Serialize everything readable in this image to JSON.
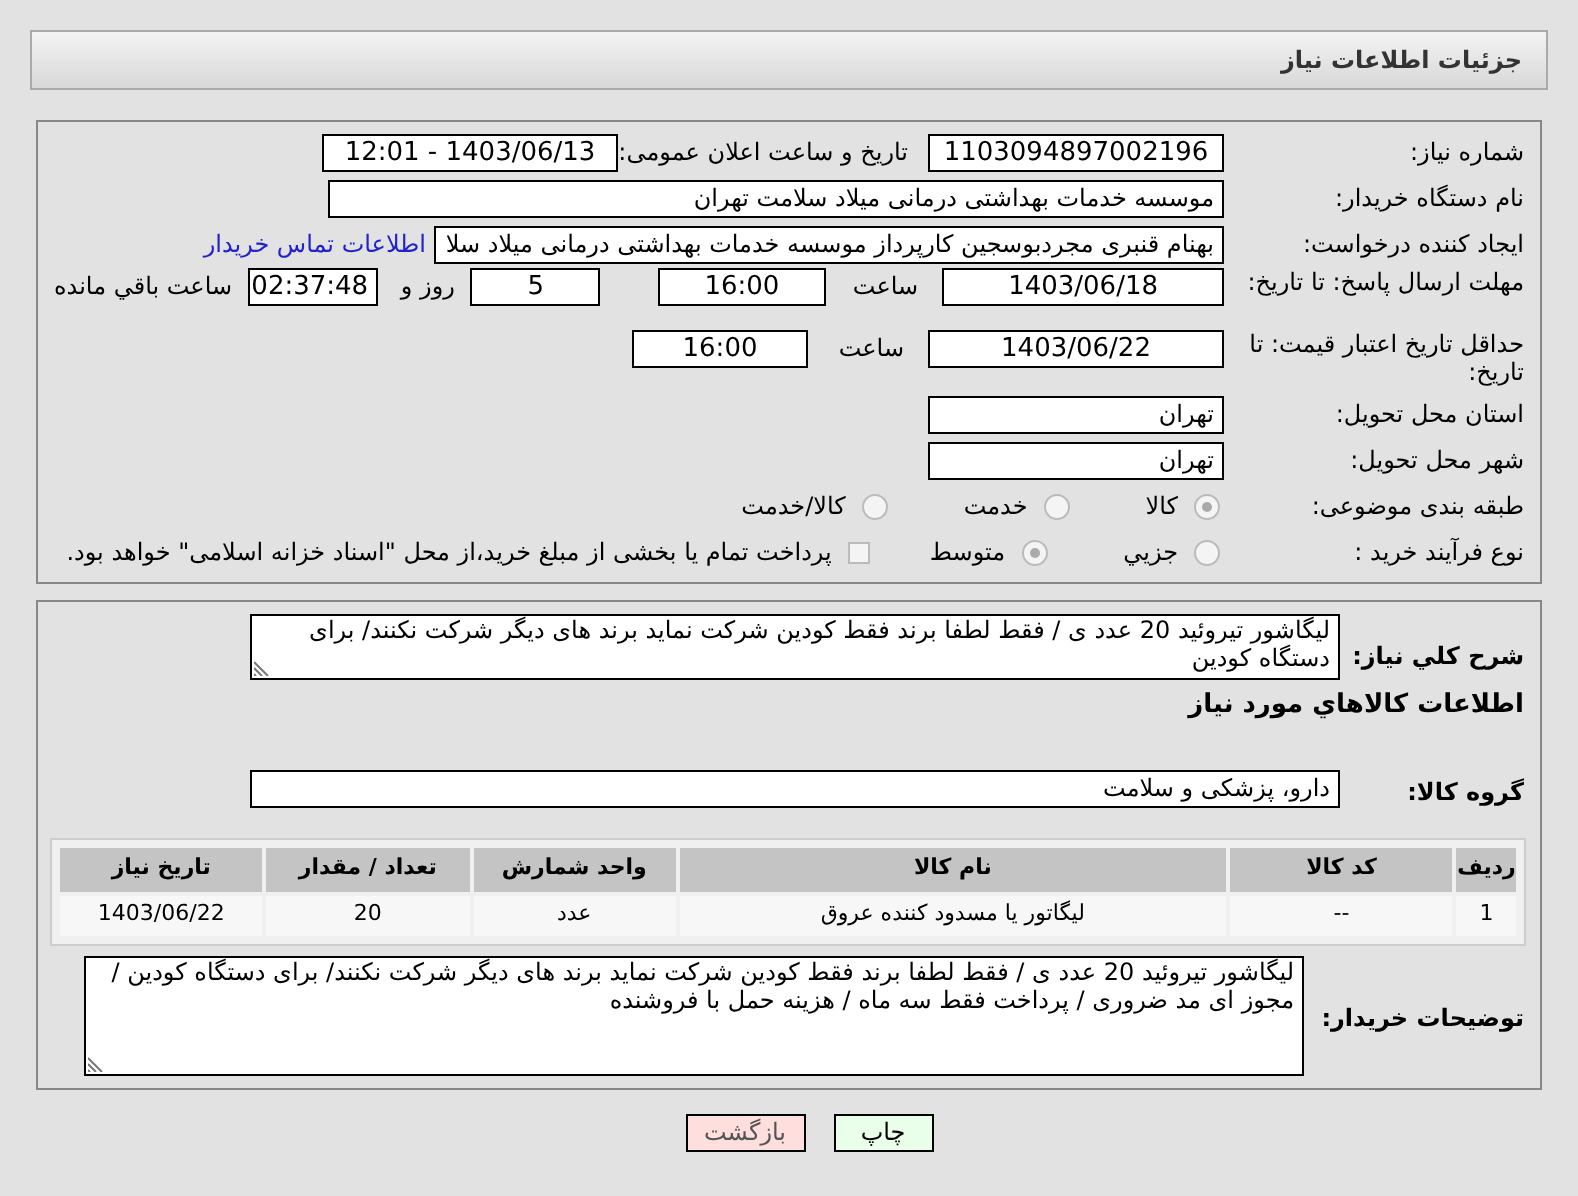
{
  "header": {
    "title": "جزئیات اطلاعات نیاز"
  },
  "need_number": {
    "label": "شماره نیاز:",
    "value": "1103094897002196"
  },
  "announce": {
    "label": "تاریخ و ساعت اعلان عمومی:",
    "value": "1403/06/13 - 12:01"
  },
  "buyer": {
    "label": "نام دستگاه خریدار:",
    "value": "موسسه خدمات بهداشتی درمانی میلاد سلامت تهران"
  },
  "creator": {
    "label": "ایجاد کننده درخواست:",
    "value": "بهنام قنبری مجردبوسجین کارپرداز موسسه خدمات بهداشتی درمانی میلاد سلا",
    "link": "اطلاعات تماس خریدار"
  },
  "reply_deadline": {
    "label": "مهلت ارسال پاسخ: تا تاریخ:",
    "date": "1403/06/18",
    "time_label": "ساعت",
    "time": "16:00",
    "days": "5",
    "days_label": "روز و",
    "remaining": "02:37:48",
    "remaining_label": "ساعت باقي مانده"
  },
  "price_validity": {
    "label": "حداقل تاریخ اعتبار قیمت: تا تاریخ:",
    "date": "1403/06/22",
    "time_label": "ساعت",
    "time": "16:00"
  },
  "province": {
    "label": "استان محل تحویل:",
    "value": "تهران"
  },
  "city": {
    "label": "شهر محل تحویل:",
    "value": "تهران"
  },
  "category": {
    "label": "طبقه بندی موضوعی:",
    "options": [
      {
        "label": "کالا",
        "selected": true
      },
      {
        "label": "خدمت",
        "selected": false
      },
      {
        "label": "کالا/خدمت",
        "selected": false
      }
    ]
  },
  "purchase_type": {
    "label": "نوع فرآیند خرید :",
    "options": [
      {
        "label": "جزیي",
        "selected": false
      },
      {
        "label": "متوسط",
        "selected": true
      }
    ],
    "treasury": {
      "label": "پرداخت تمام یا بخشی از مبلغ خرید،از محل \"اسناد خزانه اسلامی\" خواهد بود.",
      "checked": false
    }
  },
  "description": {
    "label": "شرح کلي نياز:",
    "value": "لیگاشور  تیروئید  20 عدد ی  /   فقط لطفا  برند فقط کودین  شرکت نماید برند های دیگر شرکت نکنند/ برای دستگاه کودین"
  },
  "goods_heading": "اطلاعات کالاهاي مورد نياز",
  "goods_group": {
    "label": "گروه کالا:",
    "value": "دارو، پزشکی و سلامت"
  },
  "table": {
    "columns": [
      "ردیف",
      "کد کالا",
      "نام کالا",
      "واحد شمارش",
      "تعداد / مقدار",
      "تاریخ نیاز"
    ],
    "rows": [
      [
        "1",
        "--",
        "لیگاتور یا مسدود کننده عروق",
        "عدد",
        "20",
        "1403/06/22"
      ]
    ]
  },
  "buyer_notes": {
    "label": "توضیحات خریدار:",
    "value": "لیگاشور  تیروئید  20 عدد ی  /   فقط لطفا  برند فقط کودین  شرکت نماید برند های دیگر شرکت نکنند/ برای دستگاه کودین / مجوز ای مد ضروری / پرداخت فقط سه ماه / هزینه حمل با فروشنده"
  },
  "buttons": [
    {
      "label": "چاپ",
      "kind": "print"
    },
    {
      "label": "بازگشت",
      "kind": "back"
    }
  ]
}
